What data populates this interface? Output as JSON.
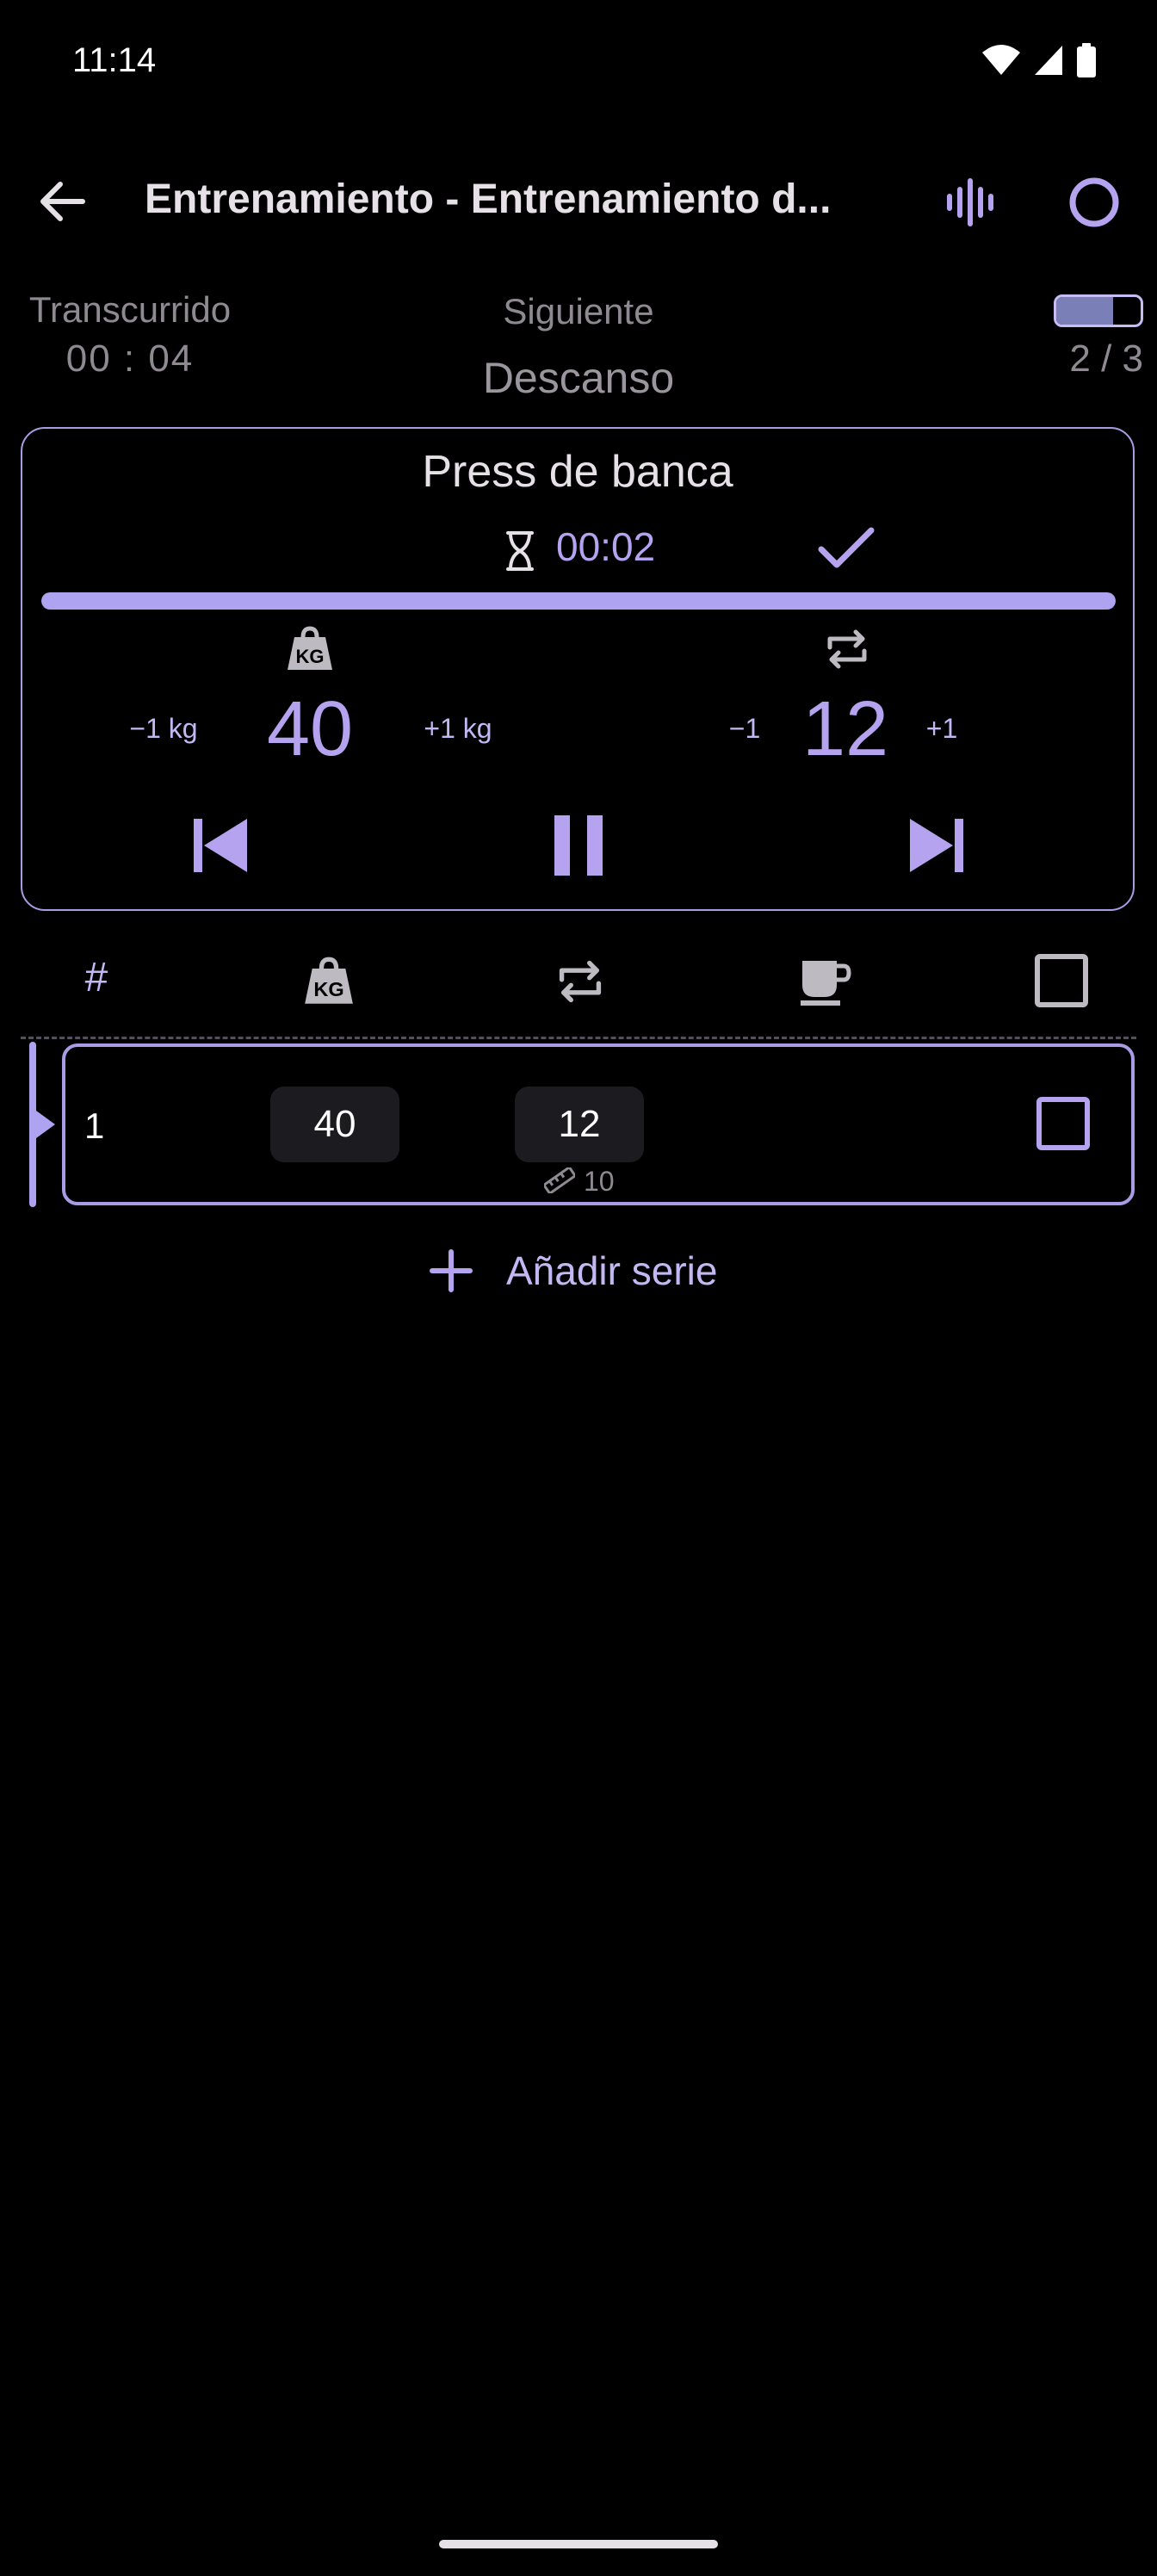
{
  "status_bar": {
    "time": "11:14"
  },
  "app_bar": {
    "title": "Entrenamiento - Entrenamiento d..."
  },
  "stats": {
    "elapsed_label": "Transcurrido",
    "elapsed_value": "00 : 04",
    "next_label": "Siguiente",
    "next_value": "Descanso",
    "exercise_progress": "2 / 3",
    "exercise_progress_fraction": 0.67
  },
  "current": {
    "exercise_name": "Press de banca",
    "timer": "00:02",
    "set_progress_fraction": 1.0,
    "weight_minus": "−1 kg",
    "weight_value": "40",
    "weight_plus": "+1 kg",
    "reps_minus": "−1",
    "reps_value": "12",
    "reps_plus": "+1"
  },
  "table": {
    "header_number": "#",
    "rows": [
      {
        "number": "1",
        "weight": "40",
        "reps": "12",
        "previous_reps": "10",
        "completed": false
      }
    ]
  },
  "add_set_label": "Añadir serie",
  "colors": {
    "accent": "#b5a3ef",
    "background": "#000000",
    "card_border": "#a99ce4"
  }
}
